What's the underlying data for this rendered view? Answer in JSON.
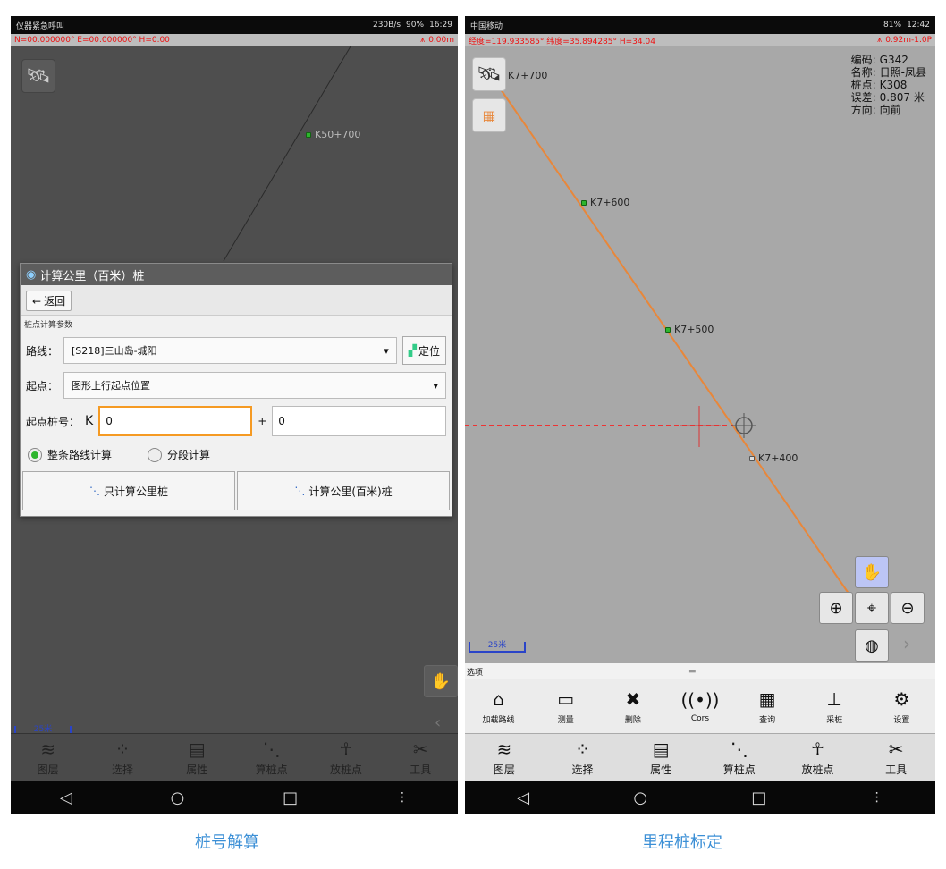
{
  "left": {
    "status": {
      "left": "仪器紧急呼叫",
      "right": "230B/s",
      "battery": "90%",
      "time": "16:29"
    },
    "gps": {
      "coords": "N=00.000000° E=00.000000° H=0.00",
      "accuracy": "0.00m"
    },
    "map": {
      "stake_label": "K50+700",
      "scale_label": "25米"
    },
    "dialog": {
      "title": "计算公里（百米）桩",
      "back_label": "返回",
      "section_label": "桩点计算参数",
      "route_label": "路线：",
      "route_value": "[S218]三山岛-城阳",
      "locate_label": "定位",
      "start_label": "起点：",
      "start_value": "图形上行起点位置",
      "start_stake_label": "起点桩号：",
      "k_prefix": "K",
      "k_value": "0",
      "plus": "+",
      "plus_value": "0",
      "radio_whole": "整条路线计算",
      "radio_segment": "分段计算",
      "btn_km_only": "只计算公里桩",
      "btn_km_hm": "计算公里(百米)桩"
    },
    "toolbar": [
      {
        "label": "图层",
        "icon": "layers-icon",
        "glyph": "≋"
      },
      {
        "label": "选择",
        "icon": "select-icon",
        "glyph": "⁘"
      },
      {
        "label": "属性",
        "icon": "properties-icon",
        "glyph": "▤"
      },
      {
        "label": "算桩点",
        "icon": "compute-stake-icon",
        "glyph": "⋱"
      },
      {
        "label": "放桩点",
        "icon": "stakeout-icon",
        "glyph": "☥"
      },
      {
        "label": "工具",
        "icon": "tools-icon",
        "glyph": "✂"
      }
    ],
    "caption": "桩号解算"
  },
  "right": {
    "status": {
      "left": "中国移动",
      "right": "81%",
      "time": "12:42"
    },
    "gps": {
      "coords": "经度=119.933585° 纬度=35.894285° H=34.04",
      "accuracy": "0.92m-1.0P"
    },
    "info": {
      "code_label": "编码:",
      "code_value": "G342",
      "name_label": "名称:",
      "name_value": "日照-凤县",
      "stake_label": "桩点:",
      "stake_value": "K308",
      "error_label": "误差:",
      "error_value": "0.807 米",
      "direction_label": "方向:",
      "direction_value": "向前"
    },
    "map": {
      "stakes": [
        "K7+700",
        "K7+600",
        "K7+500",
        "K7+400"
      ],
      "scale_label": "25米"
    },
    "options_label": "选项",
    "sub_toolbar": [
      {
        "label": "加载路线",
        "icon": "load-route-icon",
        "glyph": "⌂"
      },
      {
        "label": "测量",
        "icon": "measure-icon",
        "glyph": "▭"
      },
      {
        "label": "删除",
        "icon": "delete-icon",
        "glyph": "✖"
      },
      {
        "label": "Cors",
        "icon": "cors-icon",
        "glyph": "((•))"
      },
      {
        "label": "查询",
        "icon": "query-icon",
        "glyph": "▦"
      },
      {
        "label": "采桩",
        "icon": "collect-stake-icon",
        "glyph": "⊥"
      },
      {
        "label": "设置",
        "icon": "settings-icon",
        "glyph": "⚙"
      }
    ],
    "toolbar": [
      {
        "label": "图层",
        "icon": "layers-icon",
        "glyph": "≋"
      },
      {
        "label": "选择",
        "icon": "select-icon",
        "glyph": "⁘"
      },
      {
        "label": "属性",
        "icon": "properties-icon",
        "glyph": "▤"
      },
      {
        "label": "算桩点",
        "icon": "compute-stake-icon",
        "glyph": "⋱"
      },
      {
        "label": "放桩点",
        "icon": "stakeout-icon",
        "glyph": "☥"
      },
      {
        "label": "工具",
        "icon": "tools-icon",
        "glyph": "✂"
      }
    ],
    "caption": "里程桩标定"
  },
  "colors": {
    "route_line": "#e8873a",
    "dialog_focus": "#f59a23",
    "caption": "#3b8fd6",
    "gps_text": "#e11111"
  }
}
